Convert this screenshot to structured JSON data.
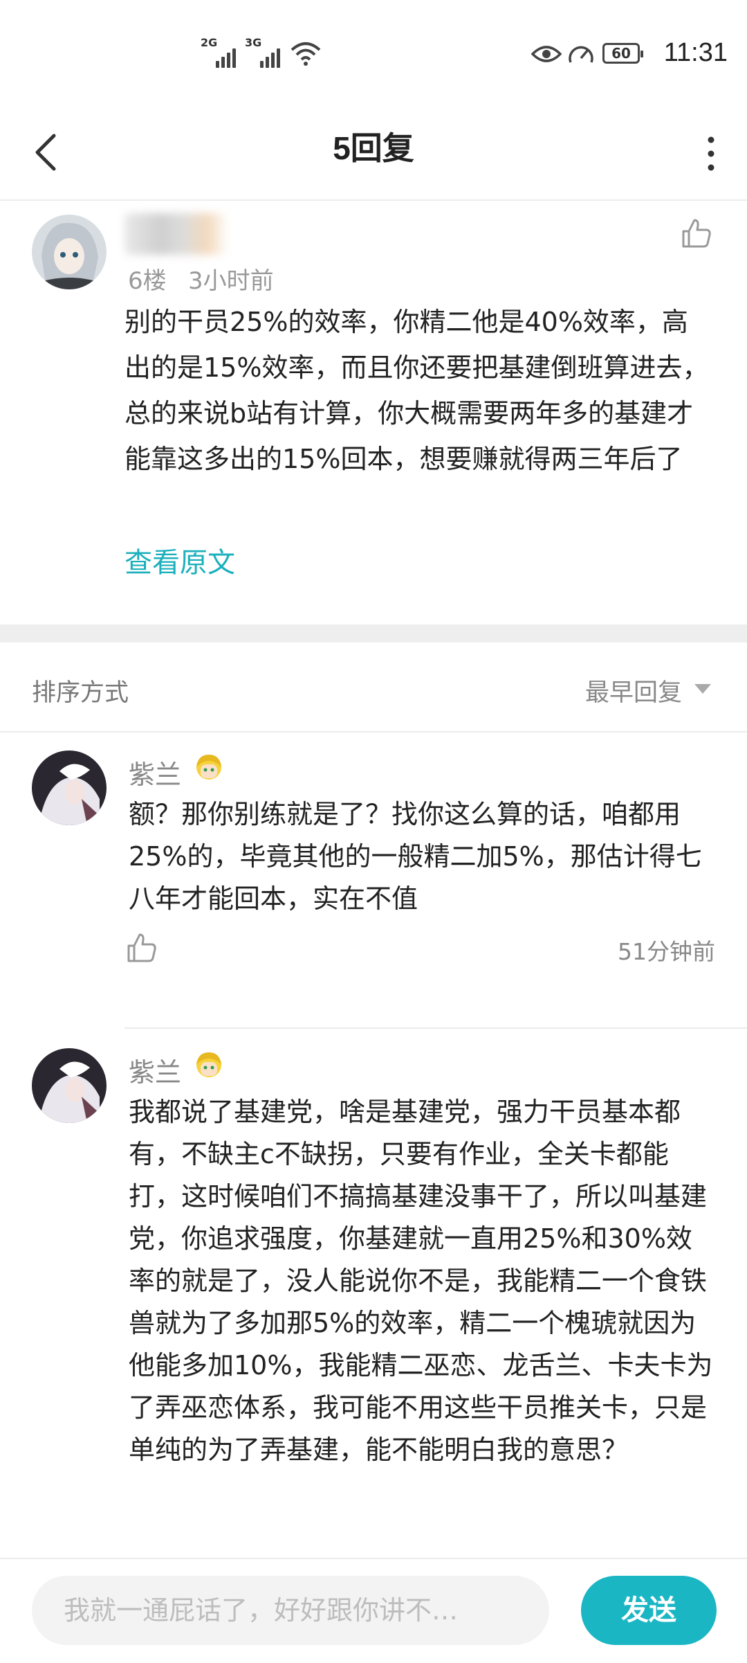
{
  "status_bar": {
    "net1": "2G",
    "net2": "3G",
    "battery": "60",
    "time": "11:31"
  },
  "header": {
    "title": "5回复"
  },
  "post": {
    "floor": "6楼",
    "time": "3小时前",
    "content": "别的干员25%的效率，你精二他是40%效率，高出的是15%效率，而且你还要把基建倒班算进去，总的来说b站有计算，你大概需要两年多的基建才能靠这多出的15%回本，想要赚就得两三年后了",
    "view_original": "查看原文"
  },
  "sort": {
    "label": "排序方式",
    "value": "最早回复"
  },
  "replies": [
    {
      "name": "紫兰",
      "content": "额？那你别练就是了？找你这么算的话，咱都用25%的，毕竟其他的一般精二加5%，那估计得七八年才能回本，实在不值",
      "time": "51分钟前"
    },
    {
      "name": "紫兰",
      "content": "我都说了基建党，啥是基建党，强力干员基本都有，不缺主c不缺拐，只要有作业，全关卡都能打，这时候咱们不搞搞基建没事干了，所以叫基建党，你追求强度，你基建就一直用25%和30%效率的就是了，没人能说你不是，我能精二一个食铁兽就为了多加那5%的效率，精二一个槐琥就因为他能多加10%，我能精二巫恋、龙舌兰、卡夫卡为了弄巫恋体系，我可能不用这些干员推关卡，只是单纯的为了弄基建，能不能明白我的意思？"
    }
  ],
  "input": {
    "placeholder": "我就一通屁话了，好好跟你讲不…",
    "send_label": "发送"
  },
  "colors": {
    "accent": "#1bb6c4",
    "link": "#1bb0bc"
  }
}
